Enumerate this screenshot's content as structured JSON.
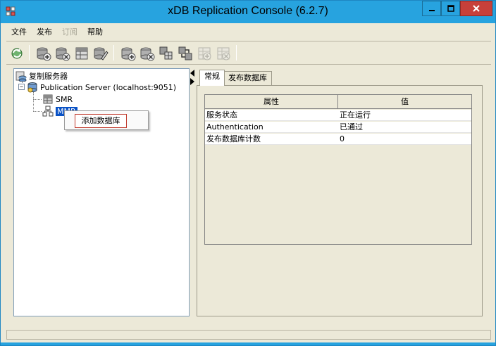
{
  "window": {
    "title": "xDB Replication Console (6.2.7)",
    "buttons": {
      "minimize": "minimize",
      "maximize": "maximize",
      "close": "close"
    }
  },
  "menu": {
    "items": [
      {
        "label": "文件",
        "enabled": true
      },
      {
        "label": "发布",
        "enabled": true
      },
      {
        "label": "订阅",
        "enabled": false
      },
      {
        "label": "帮助",
        "enabled": true
      }
    ]
  },
  "toolbar": {
    "buttons": [
      {
        "icon": "refresh-icon",
        "enabled": true
      },
      {
        "icon": "add-database-icon",
        "enabled": true
      },
      {
        "icon": "remove-database-icon",
        "enabled": true
      },
      {
        "icon": "table-icon",
        "enabled": true
      },
      {
        "icon": "edit-database-icon",
        "enabled": true
      },
      {
        "icon": "add-server-icon",
        "enabled": true
      },
      {
        "icon": "remove-server-icon",
        "enabled": true
      },
      {
        "icon": "snapshot-icon",
        "enabled": true
      },
      {
        "icon": "sync-icon",
        "enabled": true
      },
      {
        "icon": "add-subscription-icon",
        "enabled": false
      },
      {
        "icon": "remove-subscription-icon",
        "enabled": false
      }
    ]
  },
  "tree": {
    "root": "复制服务器",
    "server": "Publication Server (localhost:9051)",
    "children": [
      {
        "label": "SMR",
        "icon": "database-table-icon"
      },
      {
        "label": "MMR",
        "icon": "mmr-node-icon",
        "selected": true
      }
    ]
  },
  "context_menu": {
    "items": [
      {
        "label": "添加数据库"
      }
    ]
  },
  "tabs": [
    {
      "label": "常规",
      "active": true
    },
    {
      "label": "发布数据库",
      "active": false
    }
  ],
  "properties": {
    "headers": [
      "属性",
      "值"
    ],
    "rows": [
      [
        "服务状态",
        "正在运行"
      ],
      [
        "Authentication",
        "已通过"
      ],
      [
        "发布数据库计数",
        "0"
      ]
    ]
  },
  "colors": {
    "titlebar": "#27a3df",
    "close_button": "#c7403a",
    "selection": "#0a52c5",
    "context_highlight": "#c0392b"
  }
}
